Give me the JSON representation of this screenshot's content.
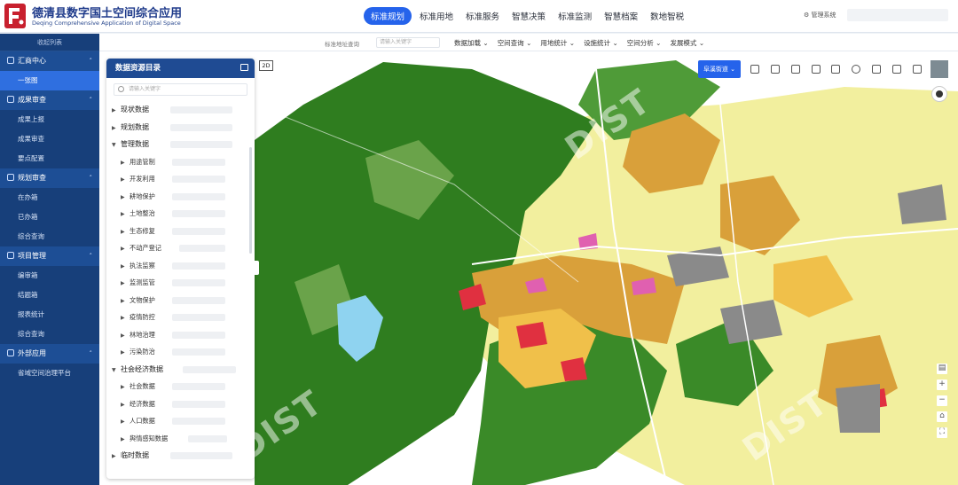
{
  "app": {
    "title": "德清县数字国土空间综合应用",
    "subtitle": "Deqing Comprehensive Application of Digital Space"
  },
  "nav": {
    "tabs": [
      "标准规划",
      "标准用地",
      "标准服务",
      "智慧决策",
      "标准监测",
      "智慧档案",
      "数地智税"
    ],
    "active_index": 0
  },
  "header": {
    "admin_label": "管理系统"
  },
  "subbar": {
    "search_label": "标准地址查询",
    "search_placeholder": "请输入关键字",
    "menus": [
      "数据加载",
      "空间查询",
      "用地统计",
      "设施统计",
      "空间分析",
      "发展模式"
    ]
  },
  "sidebar": {
    "collapse_label": "收起列表",
    "groups": [
      {
        "label": "汇商中心",
        "items": [
          "一张图"
        ]
      },
      {
        "label": "成果审查",
        "items": [
          "成果上报",
          "成果审查",
          "要点配置"
        ]
      },
      {
        "label": "规划审查",
        "items": [
          "在办箱",
          "已办箱",
          "综合查询"
        ]
      },
      {
        "label": "项目管理",
        "items": [
          "编审箱",
          "结题箱",
          "报表统计",
          "综合查询"
        ]
      },
      {
        "label": "外部应用",
        "items": [
          "省域空间治理平台"
        ]
      }
    ],
    "active_item": "一张图"
  },
  "catalog": {
    "title": "数据资源目录",
    "search_placeholder": "请输入关键字",
    "nodes": [
      {
        "label": "现状数据",
        "level": 0,
        "expanded": false
      },
      {
        "label": "规划数据",
        "level": 0,
        "expanded": false
      },
      {
        "label": "管理数据",
        "level": 0,
        "expanded": true
      },
      {
        "label": "用途管制",
        "level": 1
      },
      {
        "label": "开发利用",
        "level": 1
      },
      {
        "label": "耕地保护",
        "level": 1
      },
      {
        "label": "土地整治",
        "level": 1
      },
      {
        "label": "生态修复",
        "level": 1
      },
      {
        "label": "不动产登记",
        "level": 1
      },
      {
        "label": "执法监察",
        "level": 1
      },
      {
        "label": "监测监管",
        "level": 1
      },
      {
        "label": "文物保护",
        "level": 1
      },
      {
        "label": "疫情防控",
        "level": 1
      },
      {
        "label": "林地治理",
        "level": 1
      },
      {
        "label": "污染防治",
        "level": 1
      },
      {
        "label": "社会经济数据",
        "level": 0,
        "expanded": true
      },
      {
        "label": "社会数据",
        "level": 1
      },
      {
        "label": "经济数据",
        "level": 1
      },
      {
        "label": "人口数据",
        "level": 1
      },
      {
        "label": "舆情感知数据",
        "level": 1
      },
      {
        "label": "临时数据",
        "level": 0,
        "expanded": false
      }
    ]
  },
  "map": {
    "mode_badge": "2D",
    "street_button": "阜溪街道",
    "watermark": "DIST",
    "colors": {
      "forest": "#2f7d1f",
      "cultivated": "#f2ef9e",
      "urban": "#d9a03a",
      "residential": "#f0c04a",
      "commercial": "#e03040",
      "industrial": "#8a8a8a",
      "water": "#8fd3f0",
      "special": "#e060b0"
    }
  }
}
